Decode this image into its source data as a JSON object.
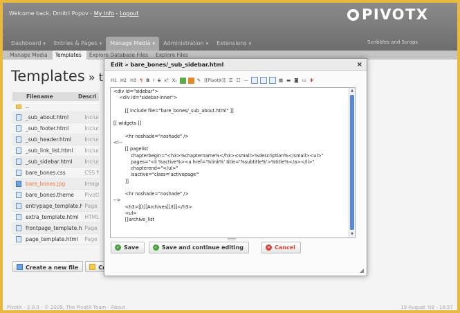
{
  "header": {
    "welcome_prefix": "Welcome back, Dmitri Popov - ",
    "my_info": "My Info",
    "separator": " - ",
    "logout": "Logout",
    "logo": "PIVOTX",
    "tagline": "Scribbles and Scraps"
  },
  "mainnav": [
    {
      "label": "Dashboard",
      "active": false
    },
    {
      "label": "Entries & Pages",
      "active": false
    },
    {
      "label": "Manage Media",
      "active": true
    },
    {
      "label": "Administration",
      "active": false
    },
    {
      "label": "Extensions",
      "active": false
    }
  ],
  "subnav": [
    {
      "label": "Manage Media",
      "active": false
    },
    {
      "label": "Templates",
      "active": true
    },
    {
      "label": "Explore Database Files",
      "active": false
    },
    {
      "label": "Explore Files",
      "active": false
    }
  ],
  "page": {
    "title": "Templates",
    "crumb": " » templ"
  },
  "filetable": {
    "headers": [
      "Filename",
      "Descri"
    ],
    "rows": [
      {
        "name": "..",
        "desc": "",
        "icon": "folder"
      },
      {
        "name": "_sub_about.html",
        "desc": "Includ",
        "icon": "file"
      },
      {
        "name": "_sub_footer.html",
        "desc": "Includ",
        "icon": "file"
      },
      {
        "name": "_sub_header.html",
        "desc": "Includ",
        "icon": "file"
      },
      {
        "name": "_sub_link_list.html",
        "desc": "Includ",
        "icon": "file"
      },
      {
        "name": "_sub_sidebar.html",
        "desc": "Includ",
        "icon": "file"
      },
      {
        "name": "bare_bones.css",
        "desc": "CSS fil",
        "icon": "file"
      },
      {
        "name": "bare_bones.jpg",
        "desc": "Image,",
        "icon": "image",
        "highlight": true
      },
      {
        "name": "bare_bones.theme",
        "desc": "PivotX",
        "icon": "file"
      },
      {
        "name": "entrypage_template.html",
        "desc": "Page te",
        "icon": "file"
      },
      {
        "name": "extra_template.html",
        "desc": "HTML t",
        "icon": "file"
      },
      {
        "name": "frontpage_template.html",
        "desc": "Page te",
        "icon": "file"
      },
      {
        "name": "page_template.html",
        "desc": "Page te",
        "icon": "file"
      }
    ]
  },
  "bottom_buttons": {
    "create_file": "Create a new file",
    "create_other": "Create"
  },
  "footer": {
    "left": "PivotX - 2.0.0  -  © 2009, The PivotX Team - About",
    "right": "19 August '09 - 10:57"
  },
  "modal": {
    "title": "Edit » bare_bones/_sub_sidebar.html",
    "close": "×",
    "toolbar": {
      "h1": "H1",
      "h2": "H2",
      "h3": "H3",
      "bold": "B",
      "italic": "I",
      "strike": "S",
      "sup": "x²",
      "sub": "X₁",
      "pivotx": "[[PivotX]]",
      "dash": "—"
    },
    "code": "<div id=\"sidebar\">\n    <div id=\"sidebar-inner\">\n\n        [[ include file=\"bare_bones/_sub_about.html\" ]]\n\n[[ widgets ]]\n\n        <hr noshade=\"noshade\" />\n<!--\n        [[ pagelist\n            chapterbegin=\"<h3>%chaptername%</h3><small>%description%</small><ul>\"\n            pages=\"<li %active%><a href='%link%' title='%subtitle%'>%title%</a></li>\"\n            chapterend=\"</ul>\"\n            isactive=\"class='activepage'\"\n        ]]\n\n        <hr noshade=\"noshade\" />\n-->\n        <h3>[[t]]Archives[[/t]]</h3>\n        <ul>\n        [[archive_list",
    "save": "Save",
    "save_continue": "Save and continue editing",
    "cancel": "Cancel"
  }
}
